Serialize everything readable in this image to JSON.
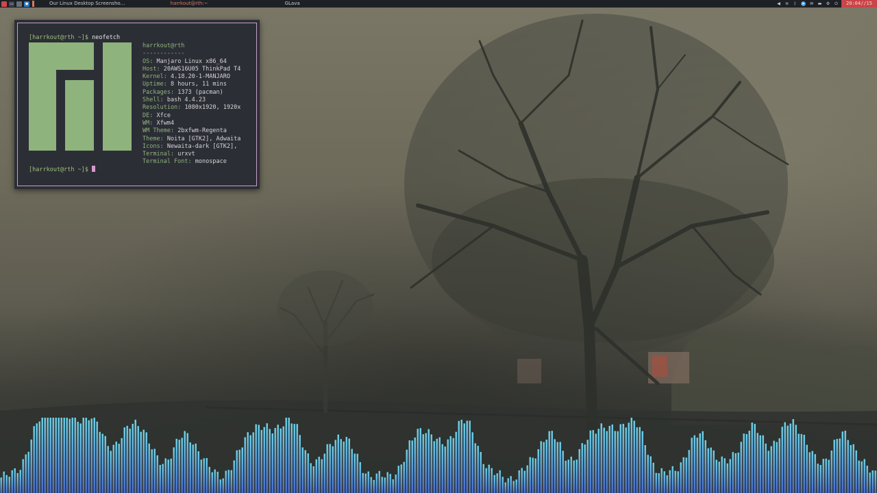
{
  "panel": {
    "launcher_icons": [
      "menu-icon",
      "terminal-icon",
      "files-icon",
      "vscode-icon",
      "separator-icon"
    ],
    "tasks": [
      {
        "label": "Our Linux Desktop Screensho…",
        "active": false
      },
      {
        "label": "harrkout@rth:~",
        "active": true
      },
      {
        "label": "GLava",
        "active": false
      }
    ],
    "tray_icons": [
      "volume-icon",
      "network-icon",
      "bluetooth-icon",
      "telegram-icon",
      "mail-icon",
      "battery-icon",
      "settings-icon",
      "power-icon"
    ],
    "clock": "20:04//15"
  },
  "terminal": {
    "prompt": "[harrkout@rth ~]$",
    "command": "neofetch",
    "user_host": "harrkout@rth",
    "separator": "------------",
    "info": [
      {
        "key": "OS",
        "value": "Manjaro Linux x86_64"
      },
      {
        "key": "Host",
        "value": "20AWS16U05 ThinkPad T4"
      },
      {
        "key": "Kernel",
        "value": "4.18.20-1-MANJARO"
      },
      {
        "key": "Uptime",
        "value": "8 hours, 11 mins"
      },
      {
        "key": "Packages",
        "value": "1373 (pacman)"
      },
      {
        "key": "Shell",
        "value": "bash 4.4.23"
      },
      {
        "key": "Resolution",
        "value": "1080x1920, 1920x"
      },
      {
        "key": "DE",
        "value": "Xfce"
      },
      {
        "key": "WM",
        "value": "Xfwm4"
      },
      {
        "key": "WM Theme",
        "value": "2bxfwm-Regenta"
      },
      {
        "key": "Theme",
        "value": "Noita [GTK2], Adwaita"
      },
      {
        "key": "Icons",
        "value": "Newaita-dark [GTK2],"
      },
      {
        "key": "Terminal",
        "value": "urxvt"
      },
      {
        "key": "Terminal Font",
        "value": "monospace"
      }
    ],
    "prompt_end": "[harrkout@rth ~]$",
    "colors": {
      "accent": "#8fb37c",
      "border": "#c7a0c6",
      "cursor": "#d79bc8",
      "background": "#2c2e36"
    }
  },
  "visualizer": {
    "colors": {
      "top": "#6fd6ee",
      "bottom": "#4a6fd0"
    }
  }
}
